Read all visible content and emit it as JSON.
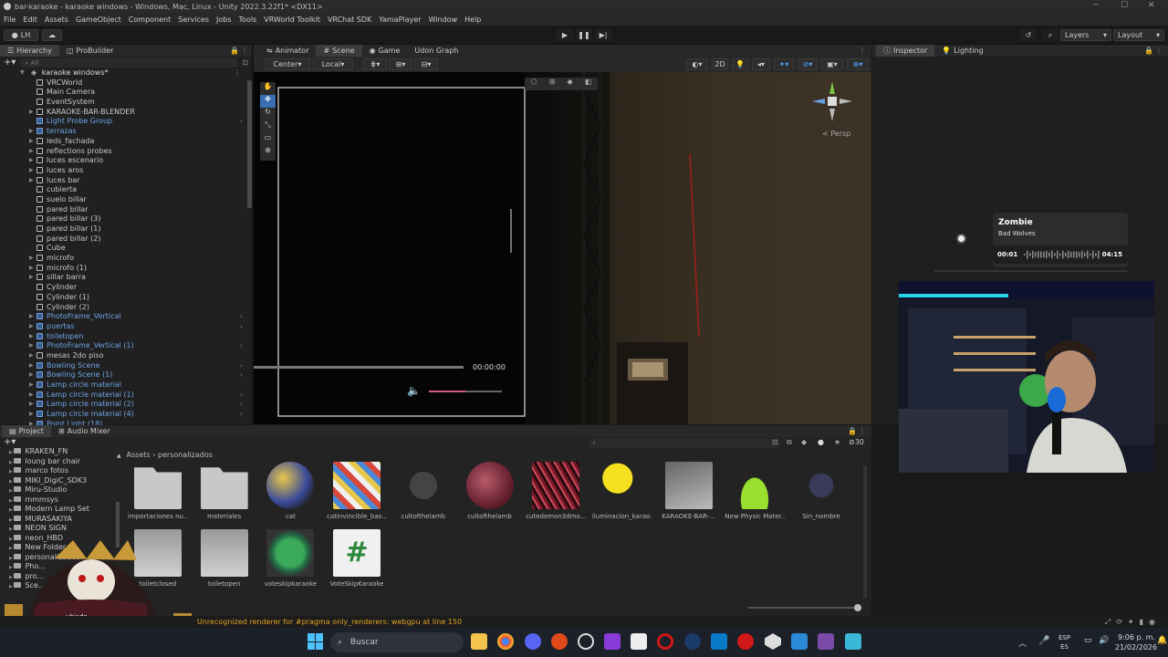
{
  "window": {
    "title": "bar-karaoke - karaoke windows - Windows, Mac, Linux - Unity 2022.3.22f1* <DX11>"
  },
  "menu": [
    "File",
    "Edit",
    "Assets",
    "GameObject",
    "Component",
    "Services",
    "Jobs",
    "Tools",
    "VRWorld Toolkit",
    "VRChat SDK",
    "YamaPlayer",
    "Window",
    "Help"
  ],
  "toolbar": {
    "account": "LH",
    "layers": "Layers",
    "layout": "Layout"
  },
  "hierarchy": {
    "tabs": [
      "Hierarchy",
      "ProBuilder"
    ],
    "search_placeholder": "All",
    "scene_name": "karaoke windows*",
    "items": [
      {
        "label": "VRCWorld",
        "blue": false,
        "arrow": false,
        "chev": false
      },
      {
        "label": "Main Camera",
        "blue": false,
        "arrow": false,
        "chev": false
      },
      {
        "label": "EventSystem",
        "blue": false,
        "arrow": false,
        "chev": false
      },
      {
        "label": "KARAOKE-BAR-BLENDER",
        "blue": false,
        "arrow": true,
        "chev": false
      },
      {
        "label": "Light Probe Group",
        "blue": true,
        "arrow": false,
        "chev": true
      },
      {
        "label": "terrazas",
        "blue": true,
        "arrow": true,
        "chev": false
      },
      {
        "label": "leds_fachada",
        "blue": false,
        "arrow": true,
        "chev": false
      },
      {
        "label": "reflections probes",
        "blue": false,
        "arrow": true,
        "chev": false
      },
      {
        "label": "luces escenario",
        "blue": false,
        "arrow": true,
        "chev": false
      },
      {
        "label": "luces aros",
        "blue": false,
        "arrow": true,
        "chev": false
      },
      {
        "label": "luces bar",
        "blue": false,
        "arrow": true,
        "chev": false
      },
      {
        "label": "cubierta",
        "blue": false,
        "arrow": false,
        "chev": false
      },
      {
        "label": "suelo billar",
        "blue": false,
        "arrow": false,
        "chev": false
      },
      {
        "label": "pared billar",
        "blue": false,
        "arrow": false,
        "chev": false
      },
      {
        "label": "pared billar (3)",
        "blue": false,
        "arrow": false,
        "chev": false
      },
      {
        "label": "pared billar (1)",
        "blue": false,
        "arrow": false,
        "chev": false
      },
      {
        "label": "pared billar (2)",
        "blue": false,
        "arrow": false,
        "chev": false
      },
      {
        "label": "Cube",
        "blue": false,
        "arrow": false,
        "chev": false
      },
      {
        "label": "microfo",
        "blue": false,
        "arrow": true,
        "chev": false
      },
      {
        "label": "microfo (1)",
        "blue": false,
        "arrow": true,
        "chev": false
      },
      {
        "label": "sillar barra",
        "blue": false,
        "arrow": true,
        "chev": false
      },
      {
        "label": "Cylinder",
        "blue": false,
        "arrow": false,
        "chev": false
      },
      {
        "label": "Cylinder (1)",
        "blue": false,
        "arrow": false,
        "chev": false
      },
      {
        "label": "Cylinder (2)",
        "blue": false,
        "arrow": false,
        "chev": false
      },
      {
        "label": "PhotoFrame_Vertical",
        "blue": true,
        "arrow": true,
        "chev": true
      },
      {
        "label": "puertas",
        "blue": true,
        "arrow": true,
        "chev": true
      },
      {
        "label": "toiletopen",
        "blue": true,
        "arrow": true,
        "chev": false
      },
      {
        "label": "PhotoFrame_Vertical (1)",
        "blue": true,
        "arrow": true,
        "chev": true
      },
      {
        "label": "mesas 2do piso",
        "blue": false,
        "arrow": true,
        "chev": false
      },
      {
        "label": "Bowling Scene",
        "blue": true,
        "arrow": true,
        "chev": true
      },
      {
        "label": "Bowling Scene (1)",
        "blue": true,
        "arrow": true,
        "chev": true
      },
      {
        "label": "Lamp circle material",
        "blue": true,
        "arrow": true,
        "chev": false
      },
      {
        "label": "Lamp circle material (1)",
        "blue": true,
        "arrow": true,
        "chev": true
      },
      {
        "label": "Lamp circle material (2)",
        "blue": true,
        "arrow": true,
        "chev": true
      },
      {
        "label": "Lamp circle material (4)",
        "blue": true,
        "arrow": true,
        "chev": true
      },
      {
        "label": "Point Light (18)",
        "blue": true,
        "arrow": true,
        "chev": false
      }
    ]
  },
  "scene": {
    "tabs": [
      "Animator",
      "Scene",
      "Game",
      "Udon Graph"
    ],
    "pivot": "Center",
    "space": "Local",
    "mode_2d": "2D",
    "persp": "< Persp",
    "video_time": "00:00:00"
  },
  "inspector": {
    "tabs": [
      "Inspector",
      "Lighting"
    ]
  },
  "music_widget": {
    "title": "Zombie",
    "artist": "Bad Wolves",
    "elapsed": "00:01",
    "remaining": "04:15"
  },
  "project": {
    "tabs": [
      "Project",
      "Audio Mixer"
    ],
    "breadcrumb": [
      "Assets",
      "personalizados"
    ],
    "count": "30",
    "tree": [
      "KRAKEN_FN",
      "loung bar chair",
      "marco fotos",
      "MIKI_DigiC_SDK3",
      "Miru-Studio",
      "mmmsys",
      "Modern Lamp Set",
      "MURASAKIYA",
      "NEON SIGN",
      "neon_HBD",
      "New Folder",
      "personalizados",
      "Pho...",
      "pro...",
      "Sce..."
    ],
    "assets_row1": [
      {
        "label": "importaciones nu...",
        "kind": "folder"
      },
      {
        "label": "materiales",
        "kind": "folder"
      },
      {
        "label": "cat",
        "kind": "cat"
      },
      {
        "label": "catinvincible_bas...",
        "kind": "pattern"
      },
      {
        "label": "cultofthelamb",
        "kind": "model"
      },
      {
        "label": "cultofthelamb",
        "kind": "sphere"
      },
      {
        "label": "cutedemon3dmo...",
        "kind": "noise"
      },
      {
        "label": "iluminacion_karao...",
        "kind": "light"
      },
      {
        "label": "KARAOKE-BAR-...",
        "kind": "mesh"
      },
      {
        "label": "New Physic Mater...",
        "kind": "physic"
      },
      {
        "label": "Sin_nombre",
        "kind": "model2"
      }
    ],
    "assets_row2": [
      {
        "label": "toiletclosed",
        "kind": "toilet"
      },
      {
        "label": "toiletopen",
        "kind": "toilet"
      },
      {
        "label": "voteskipkaraoke",
        "kind": "udon"
      },
      {
        "label": "VoteSkipKaraoke",
        "kind": "csharp"
      }
    ]
  },
  "status": {
    "message": "Unrecognized renderer for #pragma only_renderers: webgpu at line 150"
  },
  "overlay": {
    "text": "ubiado"
  },
  "taskbar": {
    "search_placeholder": "Buscar",
    "lang": "ESP",
    "lang_sub": "ES",
    "time": "9:06 p. m.",
    "date": "21/02/2026"
  }
}
